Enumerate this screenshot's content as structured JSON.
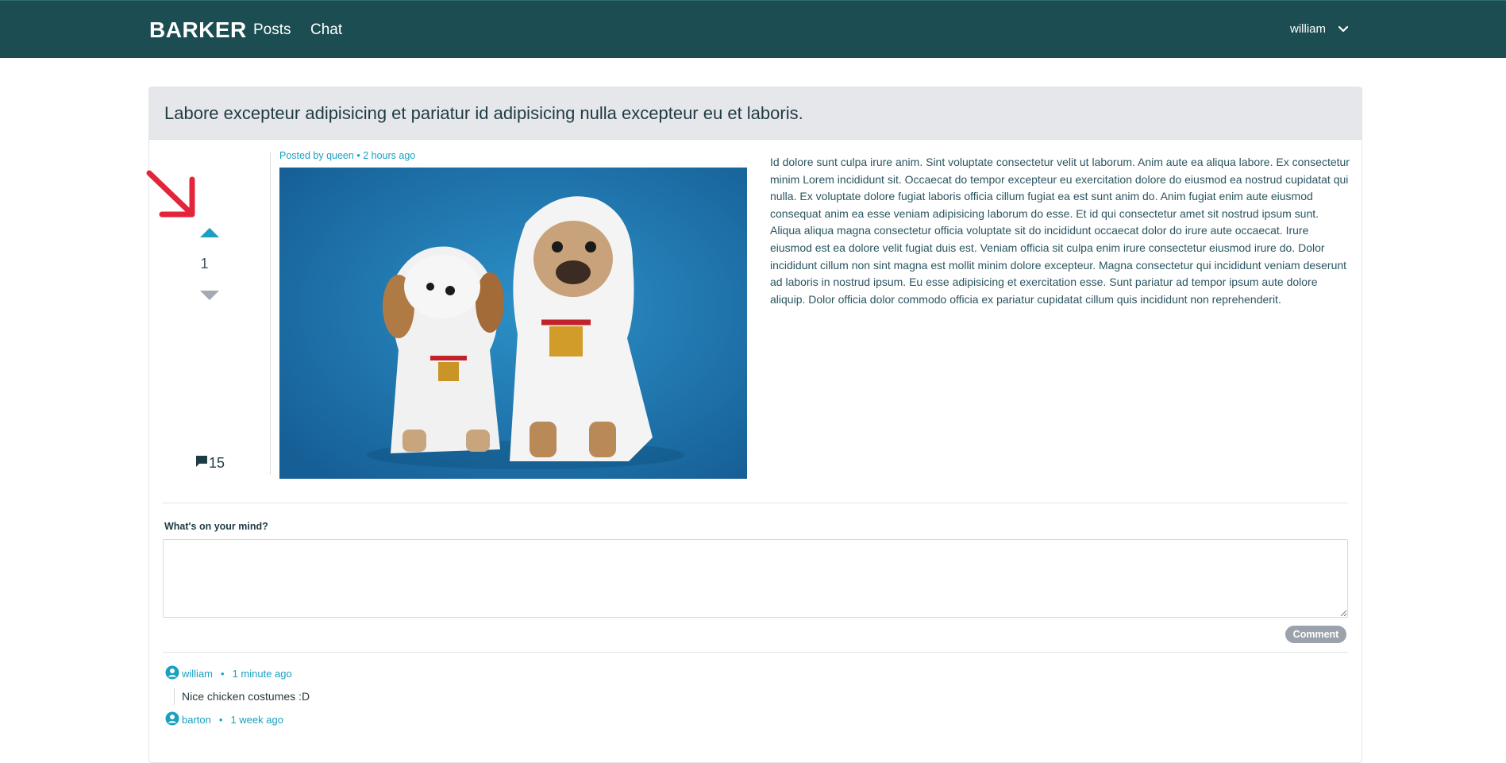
{
  "nav": {
    "brand": "BARKER",
    "links": [
      "Posts",
      "Chat"
    ],
    "user": "william"
  },
  "post": {
    "title": "Labore excepteur adipisicing et pariatur id adipisicing nulla excepteur eu et laboris.",
    "author": "queen",
    "time": "2 hours ago",
    "posted_by_prefix": "Posted by",
    "votes": "1",
    "comment_count": "15",
    "body": "Id dolore sunt culpa irure anim. Sint voluptate consectetur velit ut laborum. Anim aute ea aliqua labore. Ex consectetur minim Lorem incididunt sit. Occaecat do tempor excepteur eu exercitation dolore do eiusmod ea nostrud cupidatat qui nulla. Ex voluptate dolore fugiat laboris officia cillum fugiat ea est sunt anim do. Anim fugiat enim aute eiusmod consequat anim ea esse veniam adipisicing laborum do esse. Et id qui consectetur amet sit nostrud ipsum sunt. Aliqua aliqua magna consectetur officia voluptate sit do incididunt occaecat dolor do irure aute occaecat. Irure eiusmod est ea dolore velit fugiat duis est. Veniam officia sit culpa enim irure consectetur eiusmod irure do. Dolor incididunt cillum non sint magna est mollit minim dolore excepteur. Magna consectetur qui incididunt veniam deserunt ad laboris in nostrud ipsum. Eu esse adipisicing et exercitation esse. Sunt pariatur ad tempor ipsum aute dolore aliquip. Dolor officia dolor commodo officia ex pariatur cupidatat cillum quis incididunt non reprehenderit."
  },
  "comment_form": {
    "label": "What's on your mind?",
    "placeholder": "",
    "button": "Comment"
  },
  "comments": [
    {
      "user": "william",
      "time": "1 minute ago",
      "text": "Nice chicken costumes :D"
    },
    {
      "user": "barton",
      "time": "1 week ago",
      "text": ""
    }
  ],
  "colors": {
    "navbar": "#1c4d52",
    "accent": "#1aa0c0",
    "annotation_arrow": "#e3243b"
  }
}
